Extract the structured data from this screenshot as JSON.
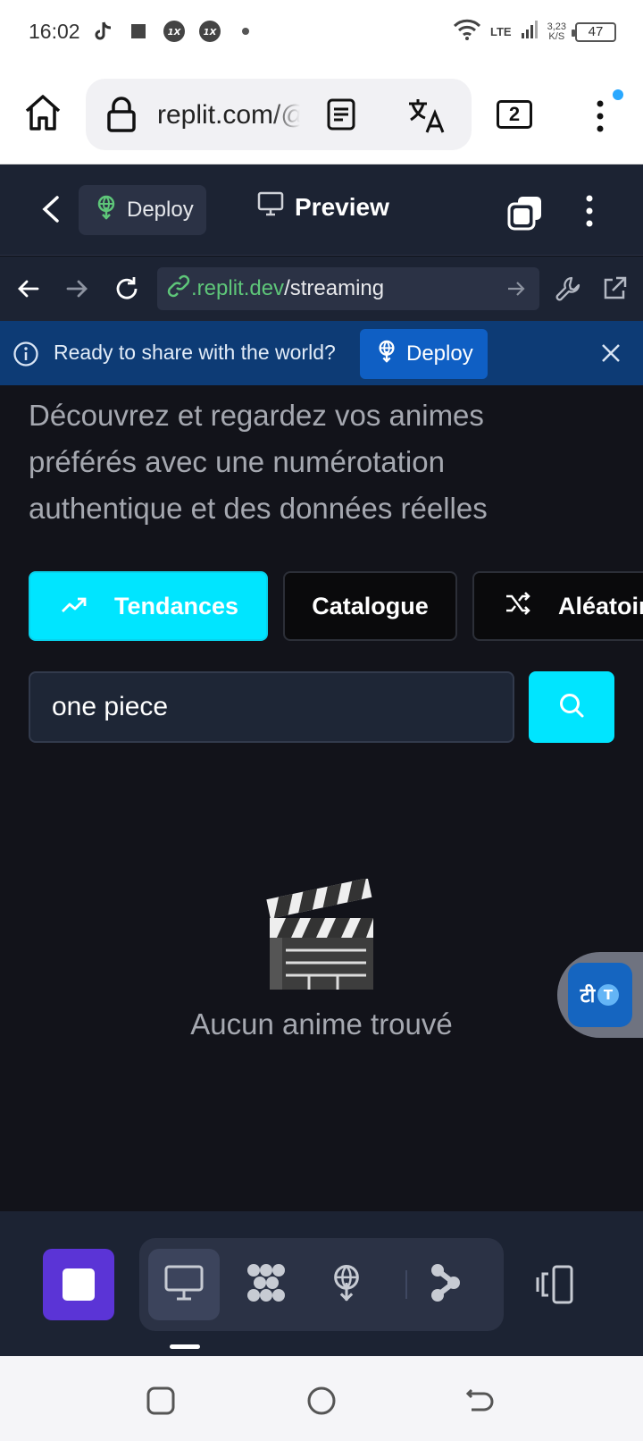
{
  "status_bar": {
    "time": "16:02",
    "network": "LTE",
    "speed_value": "3,23",
    "speed_unit": "K/S",
    "battery": "47"
  },
  "browser": {
    "url": "replit.com/@",
    "tab_count": "2"
  },
  "replit_header": {
    "deploy_label": "Deploy",
    "preview_label": "Preview"
  },
  "replit_urlbar": {
    "url_domain": ".replit.dev",
    "url_path": "/streaming"
  },
  "banner": {
    "message": "Ready to share with the world?",
    "deploy_label": "Deploy"
  },
  "page": {
    "subtitle": "Découvrez et regardez vos animes préférés avec une numérotation authentique et des données réelles",
    "tabs": [
      {
        "label": "Tendances",
        "icon": "trending-up-icon",
        "active": true
      },
      {
        "label": "Catalogue",
        "active": false
      },
      {
        "label": "Aléatoire",
        "icon": "shuffle-icon",
        "active": false
      }
    ],
    "search": {
      "value": "one piece",
      "placeholder": ""
    },
    "empty_emoji": "🎬",
    "empty_message": "Aucun anime trouvé"
  },
  "floating": {
    "label": "टी"
  },
  "colors": {
    "accent": "#00e5ff",
    "replit_bg": "#1c2333",
    "banner_bg": "#0d3b75",
    "stop_purple": "#5b34d6",
    "url_green": "#5ec679"
  }
}
